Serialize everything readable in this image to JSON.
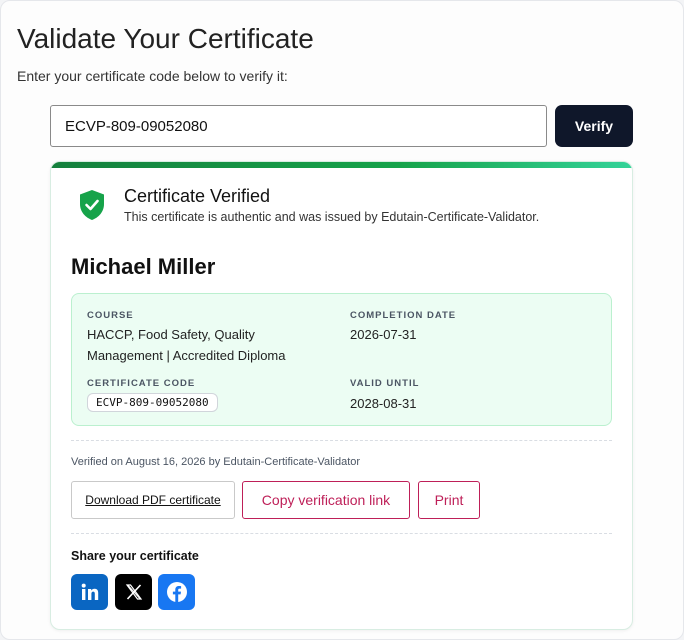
{
  "header": {
    "title": "Validate Your Certificate",
    "subtitle": "Enter your certificate code below to verify it:"
  },
  "search": {
    "value": "ECVP-809-09052080",
    "button_label": "Verify"
  },
  "result": {
    "status_title": "Certificate Verified",
    "status_description": "This certificate is authentic and was issued by Edutain-Certificate-Validator.",
    "holder_name": "Michael Miller",
    "details": {
      "course_label": "COURSE",
      "course_line1": "HACCP, Food Safety, Quality",
      "course_line2": "Management | Accredited Diploma",
      "completion_label": "COMPLETION DATE",
      "completion_value": "2026-07-31",
      "code_label": "CERTIFICATE CODE",
      "code_value": "ECVP-809-09052080",
      "valid_label": "VALID UNTIL",
      "valid_value": "2028-08-31"
    },
    "verified_on": "Verified on August 16, 2026 by Edutain-Certificate-Validator",
    "actions": {
      "download_label": "Download PDF certificate",
      "copy_label": "Copy verification link",
      "print_label": "Print"
    },
    "share": {
      "title": "Share your certificate",
      "networks": [
        "linkedin-icon",
        "x-icon",
        "facebook-icon"
      ]
    }
  },
  "colors": {
    "accent_green": "#16a34a",
    "details_bg": "#ecfdf3",
    "action_red": "#be1f58",
    "verify_button": "#0f172a",
    "linkedin": "#0a66c2",
    "x": "#000000",
    "facebook": "#1877f2"
  }
}
